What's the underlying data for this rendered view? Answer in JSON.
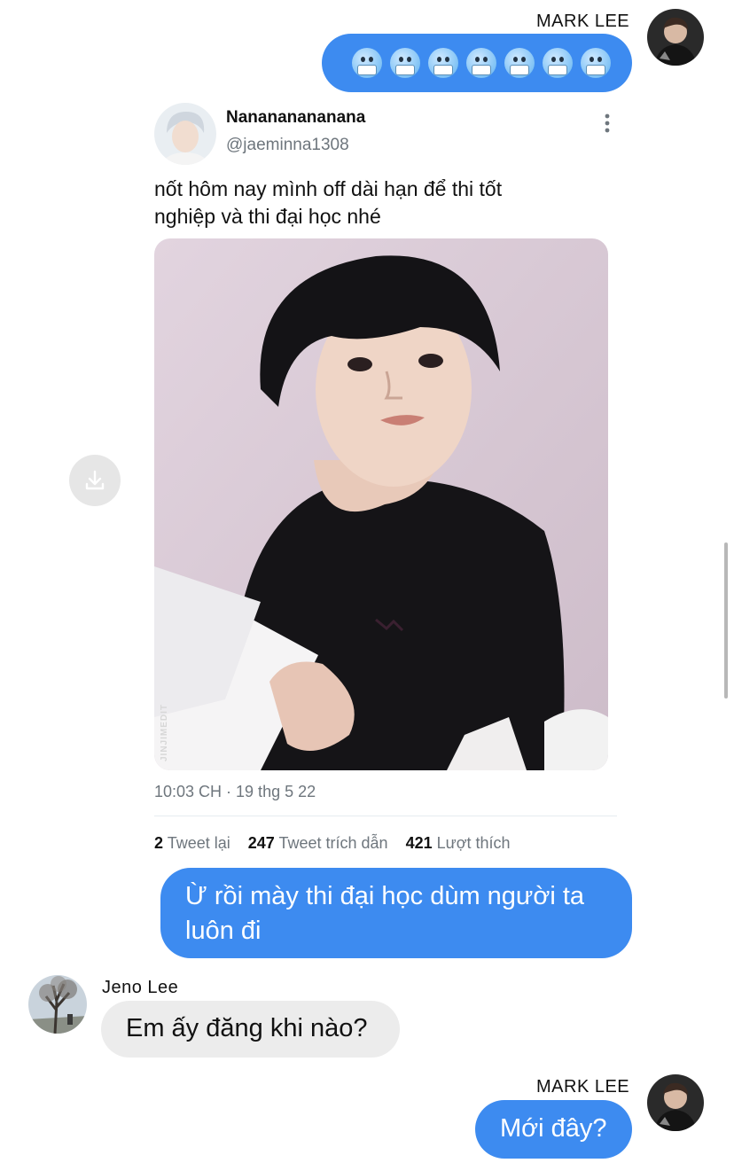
{
  "messages": {
    "m1": {
      "sender": "MARK LEE",
      "emoji_count": 7,
      "emoji_icon": "freezing-face-icon"
    },
    "shared_tweet": {
      "display_name": "Nanananananana",
      "handle": "@jaeminna1308",
      "text_line1": "nốt hôm nay mình off dài hạn để thi tốt",
      "text_line2": "nghiệp và thi đại học nhé",
      "watermark": "JINJIMEDIT",
      "timestamp": "10:03 CH · 19 thg 5 22",
      "stats": {
        "retweets_count": "2",
        "retweets_label": "Tweet lại",
        "quotes_count": "247",
        "quotes_label": "Tweet trích dẫn",
        "likes_count": "421",
        "likes_label": "Lượt thích"
      }
    },
    "m2": {
      "line1": "Ừ rồi mày thi đại học dùm người ta",
      "line2": "luôn đi"
    },
    "m3": {
      "sender": "Jeno Lee",
      "text": "Em ấy đăng khi nào?"
    },
    "m4": {
      "sender": "MARK LEE",
      "text": "Mới đây?"
    }
  },
  "colors": {
    "outgoing_bubble": "#3d8bf0",
    "incoming_bubble": "#ececec"
  }
}
